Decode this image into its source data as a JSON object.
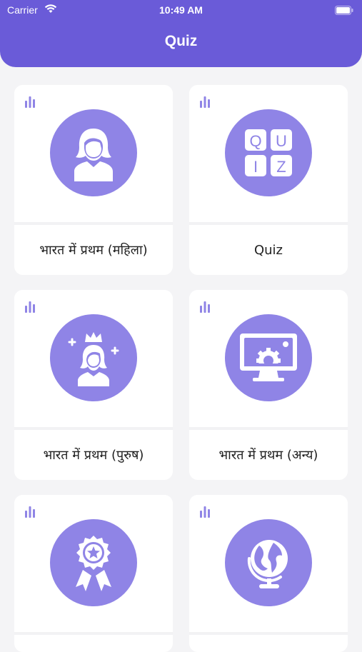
{
  "status_bar": {
    "carrier": "Carrier",
    "time": "10:49 AM"
  },
  "header": {
    "title": "Quiz"
  },
  "colors": {
    "accent": "#6a5bd8",
    "circle": "#8f84e6"
  },
  "cards": [
    {
      "label": "भारत में प्रथम (महिला)",
      "icon": "woman-avatar-icon"
    },
    {
      "label": "Quiz",
      "icon": "quiz-tiles-icon",
      "tiles": [
        "Q",
        "U",
        "I",
        "Z"
      ]
    },
    {
      "label": "भारत में प्रथम (पुरुष)",
      "icon": "crowned-person-icon"
    },
    {
      "label": "भारत में प्रथम (अन्य)",
      "icon": "monitor-gear-icon"
    },
    {
      "label": "",
      "icon": "award-badge-icon"
    },
    {
      "label": "",
      "icon": "globe-icon"
    }
  ]
}
